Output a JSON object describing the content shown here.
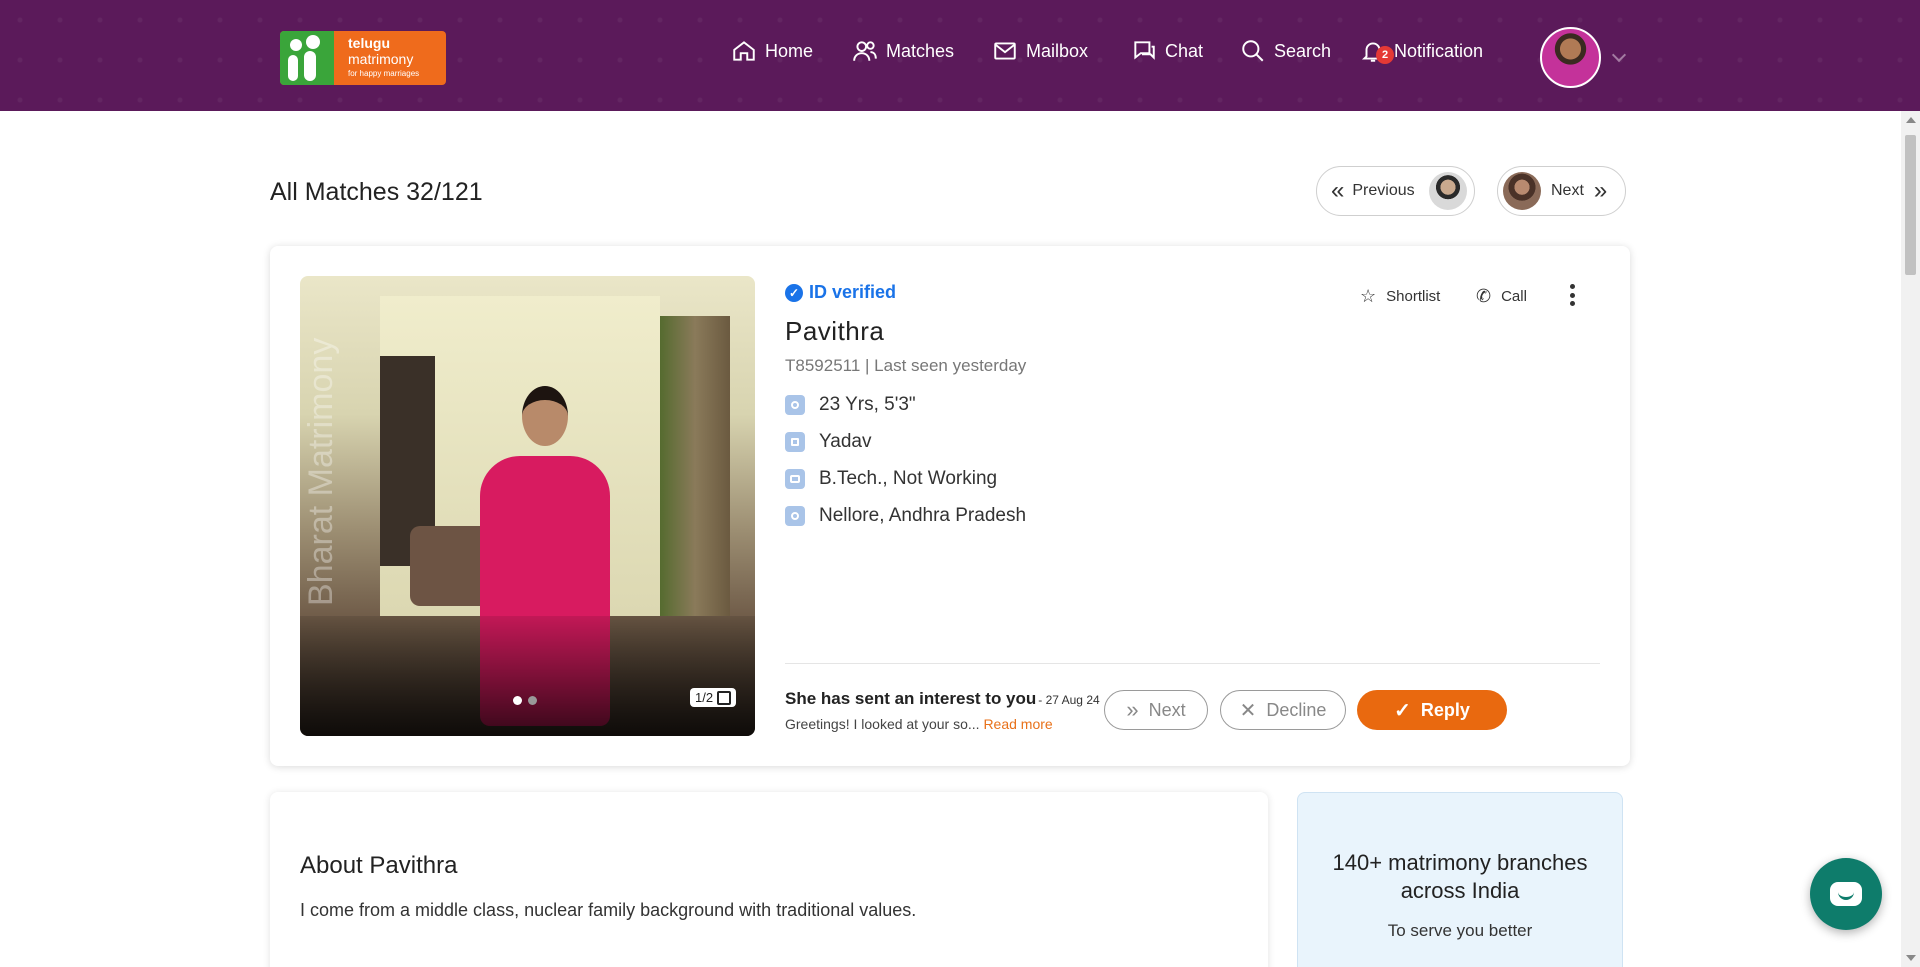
{
  "header": {
    "logo": {
      "line1": "telugu",
      "line2": "matrimony",
      "tagline": "for happy marriages"
    },
    "nav": [
      {
        "label": "Home",
        "icon": "home-icon"
      },
      {
        "label": "Matches",
        "icon": "users-icon"
      },
      {
        "label": "Mailbox",
        "icon": "mail-icon"
      },
      {
        "label": "Chat",
        "icon": "chat-icon"
      },
      {
        "label": "Search",
        "icon": "search-icon"
      },
      {
        "label": "Notification",
        "icon": "bell-icon",
        "badge": "2"
      }
    ]
  },
  "title_row": {
    "title": "All Matches 32/121",
    "previous_label": "Previous",
    "next_label": "Next"
  },
  "profile": {
    "verified_label": "ID verified",
    "name": "Pavithra",
    "id_line": "T8592511 | Last seen yesterday",
    "attributes": [
      {
        "icon": "age-height-icon",
        "text": "23 Yrs, 5'3\""
      },
      {
        "icon": "caste-icon",
        "text": "Yadav"
      },
      {
        "icon": "education-icon",
        "text": "B.Tech., Not Working"
      },
      {
        "icon": "location-icon",
        "text": "Nellore, Andhra Pradesh"
      }
    ],
    "photo": {
      "watermark": "Bharat Matrimony",
      "counter": "1/2"
    },
    "shortlist_label": "Shortlist",
    "call_label": "Call",
    "interest": {
      "title": "She has sent an interest to you",
      "date": "- 27 Aug 24",
      "message": "Greetings! I looked at your so...",
      "read_more": "Read more"
    },
    "buttons": {
      "next": "Next",
      "decline": "Decline",
      "reply": "Reply"
    }
  },
  "about": {
    "title": "About Pavithra",
    "text": "I come from a middle class, nuclear family background with traditional values."
  },
  "branches": {
    "title": "140+ matrimony branches across India",
    "subtitle": "To serve you better"
  },
  "colors": {
    "header_bg": "#5b1a5a",
    "accent_orange": "#e9690f",
    "verified_blue": "#1a73e8",
    "chat_fab": "#0e7c6b"
  }
}
